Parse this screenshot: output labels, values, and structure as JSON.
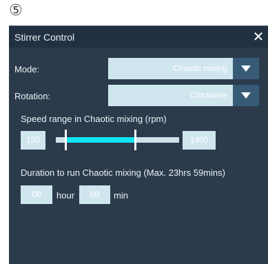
{
  "step_marker": "⑤",
  "dialog": {
    "title": "Stirrer Control",
    "close_glyph": "✕"
  },
  "mode": {
    "label": "Mode:",
    "value": "Chaotic mixing"
  },
  "rotation": {
    "label": "Rotation:",
    "value": "Clockwise"
  },
  "speed": {
    "label": "Speed range in Chaotic mixing (rpm)",
    "min_value": "150",
    "max_value": "1400",
    "range_low_fraction": 0.08,
    "range_high_fraction": 0.64
  },
  "duration": {
    "label": "Duration to run Chaotic mixing (Max. 23hrs 59mins)",
    "hours_value": "00",
    "hours_unit": "hour",
    "minutes_value": "00",
    "minutes_unit": "min"
  },
  "icons": {
    "close": "close-icon",
    "dropdown": "caret-down-icon"
  },
  "colors": {
    "dialog_bg": "#2b3b4c",
    "field_bg": "#d0e6ef",
    "slider_fill": "#12e4f2",
    "arrow_bg": "#375b77"
  }
}
